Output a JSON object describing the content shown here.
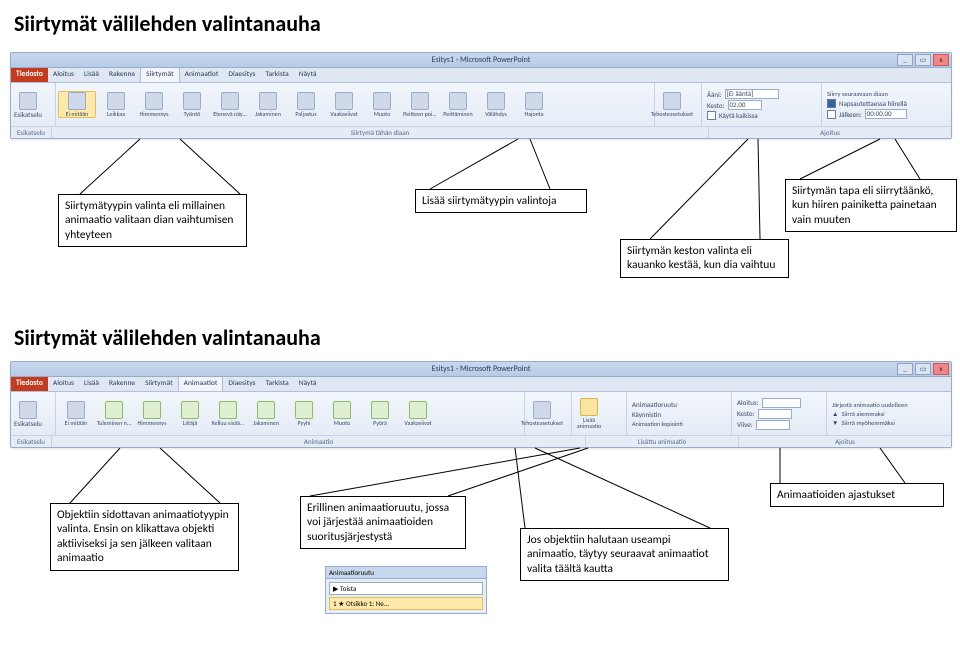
{
  "heading1": "Siirtymät välilehden valintanauha",
  "heading2": "Siirtymät välilehden valintanauha",
  "windowTitle": "Esitys1 - Microsoft PowerPoint",
  "fileTab": "Tiedosto",
  "tabs": [
    "Aloitus",
    "Lisää",
    "Rakenne",
    "Siirtymät",
    "Animaatiot",
    "Diaesitys",
    "Tarkista",
    "Näytä"
  ],
  "activeTab1": "Siirtymät",
  "activeTab2": "Animaatiot",
  "r1": {
    "group1Label": "Esikatselu",
    "group1Btn": "Esikatselu",
    "transitions": [
      "Ei mitään",
      "Leikkaa",
      "Himmennys",
      "Työntö",
      "Etenevä näy...",
      "Jakaminen",
      "Paljastus",
      "Vaakaviivat",
      "Muoto",
      "Peitteen poi...",
      "Peittäminen",
      "Välähdys",
      "Hajonta"
    ],
    "effBtn": "Tehosteasetukset",
    "group2Label": "Siirtymä tähän diaan",
    "soundLabel": "Ääni:",
    "soundValue": "[Ei ääntä]",
    "durLabel": "Kesto:",
    "durValue": "02,00",
    "applyAll": "Käytä kaikissa",
    "advanceHead": "Siirry seuraavaan diaan",
    "onClick": "Napsautettaessa hiirellä",
    "afterLabel": "Jälkeen:",
    "afterValue": "00:00,00",
    "group3Label": "Ajoitus"
  },
  "r2": {
    "group1Label": "Esikatselu",
    "group1Btn": "Esikatselu",
    "anims": [
      "Ei mitään",
      "Tuleminen n...",
      "Himmennys",
      "Liitäjä",
      "Kelluu sisää...",
      "Jakaminen",
      "Pyyhi",
      "Muoto",
      "Pyörä",
      "Vaakaviivat"
    ],
    "effBtn": "Tehosteasetukset",
    "group2Label": "Animaatio",
    "addAnim": "Lisää animaatio",
    "paneBtn": "Animaatioruutu",
    "trigBtn": "Käynnistin",
    "painterBtn": "Animaation kopiointi",
    "group3Label": "Lisättu animaatio",
    "startLabel": "Aloitus:",
    "durLabel": "Kesto:",
    "delayLabel": "Viive:",
    "reorderHead": "Järjestä animaatio uudelleen",
    "moveEarlier": "Siirrä aiemmaksi",
    "moveLater": "Siirrä myöhemmäksi",
    "group4Label": "Ajoitus"
  },
  "annot1": {
    "a": "Siirtymätyypin valinta eli millainen animaatio valitaan dian vaihtumisen yhteyteen",
    "b": "Lisää siirtymätyypin valintoja",
    "c": "Siirtymän keston valinta eli kauanko kestää, kun dia vaihtuu",
    "d": "Siirtymän tapa eli siirrytäänkö, kun hiiren painiketta painetaan vain muuten"
  },
  "annot2": {
    "a": "Objektiin sidottavan animaatiotyypin valinta. Ensin on klikattava objekti aktiiviseksi ja sen jälkeen valitaan animaatio",
    "b": "Erillinen animaatioruutu, jossa voi järjestää animaatioiden suoritusjärjestystä",
    "c": "Jos objektiin halutaan useampi animaatio, täytyy seuraavat animaatiot valita täältä kautta",
    "d": "Animaatioiden ajastukset"
  },
  "pane": {
    "title": "Animaatioruutu",
    "play": "Toista",
    "item": "1 ★ Otsikko 1: Ne..."
  }
}
